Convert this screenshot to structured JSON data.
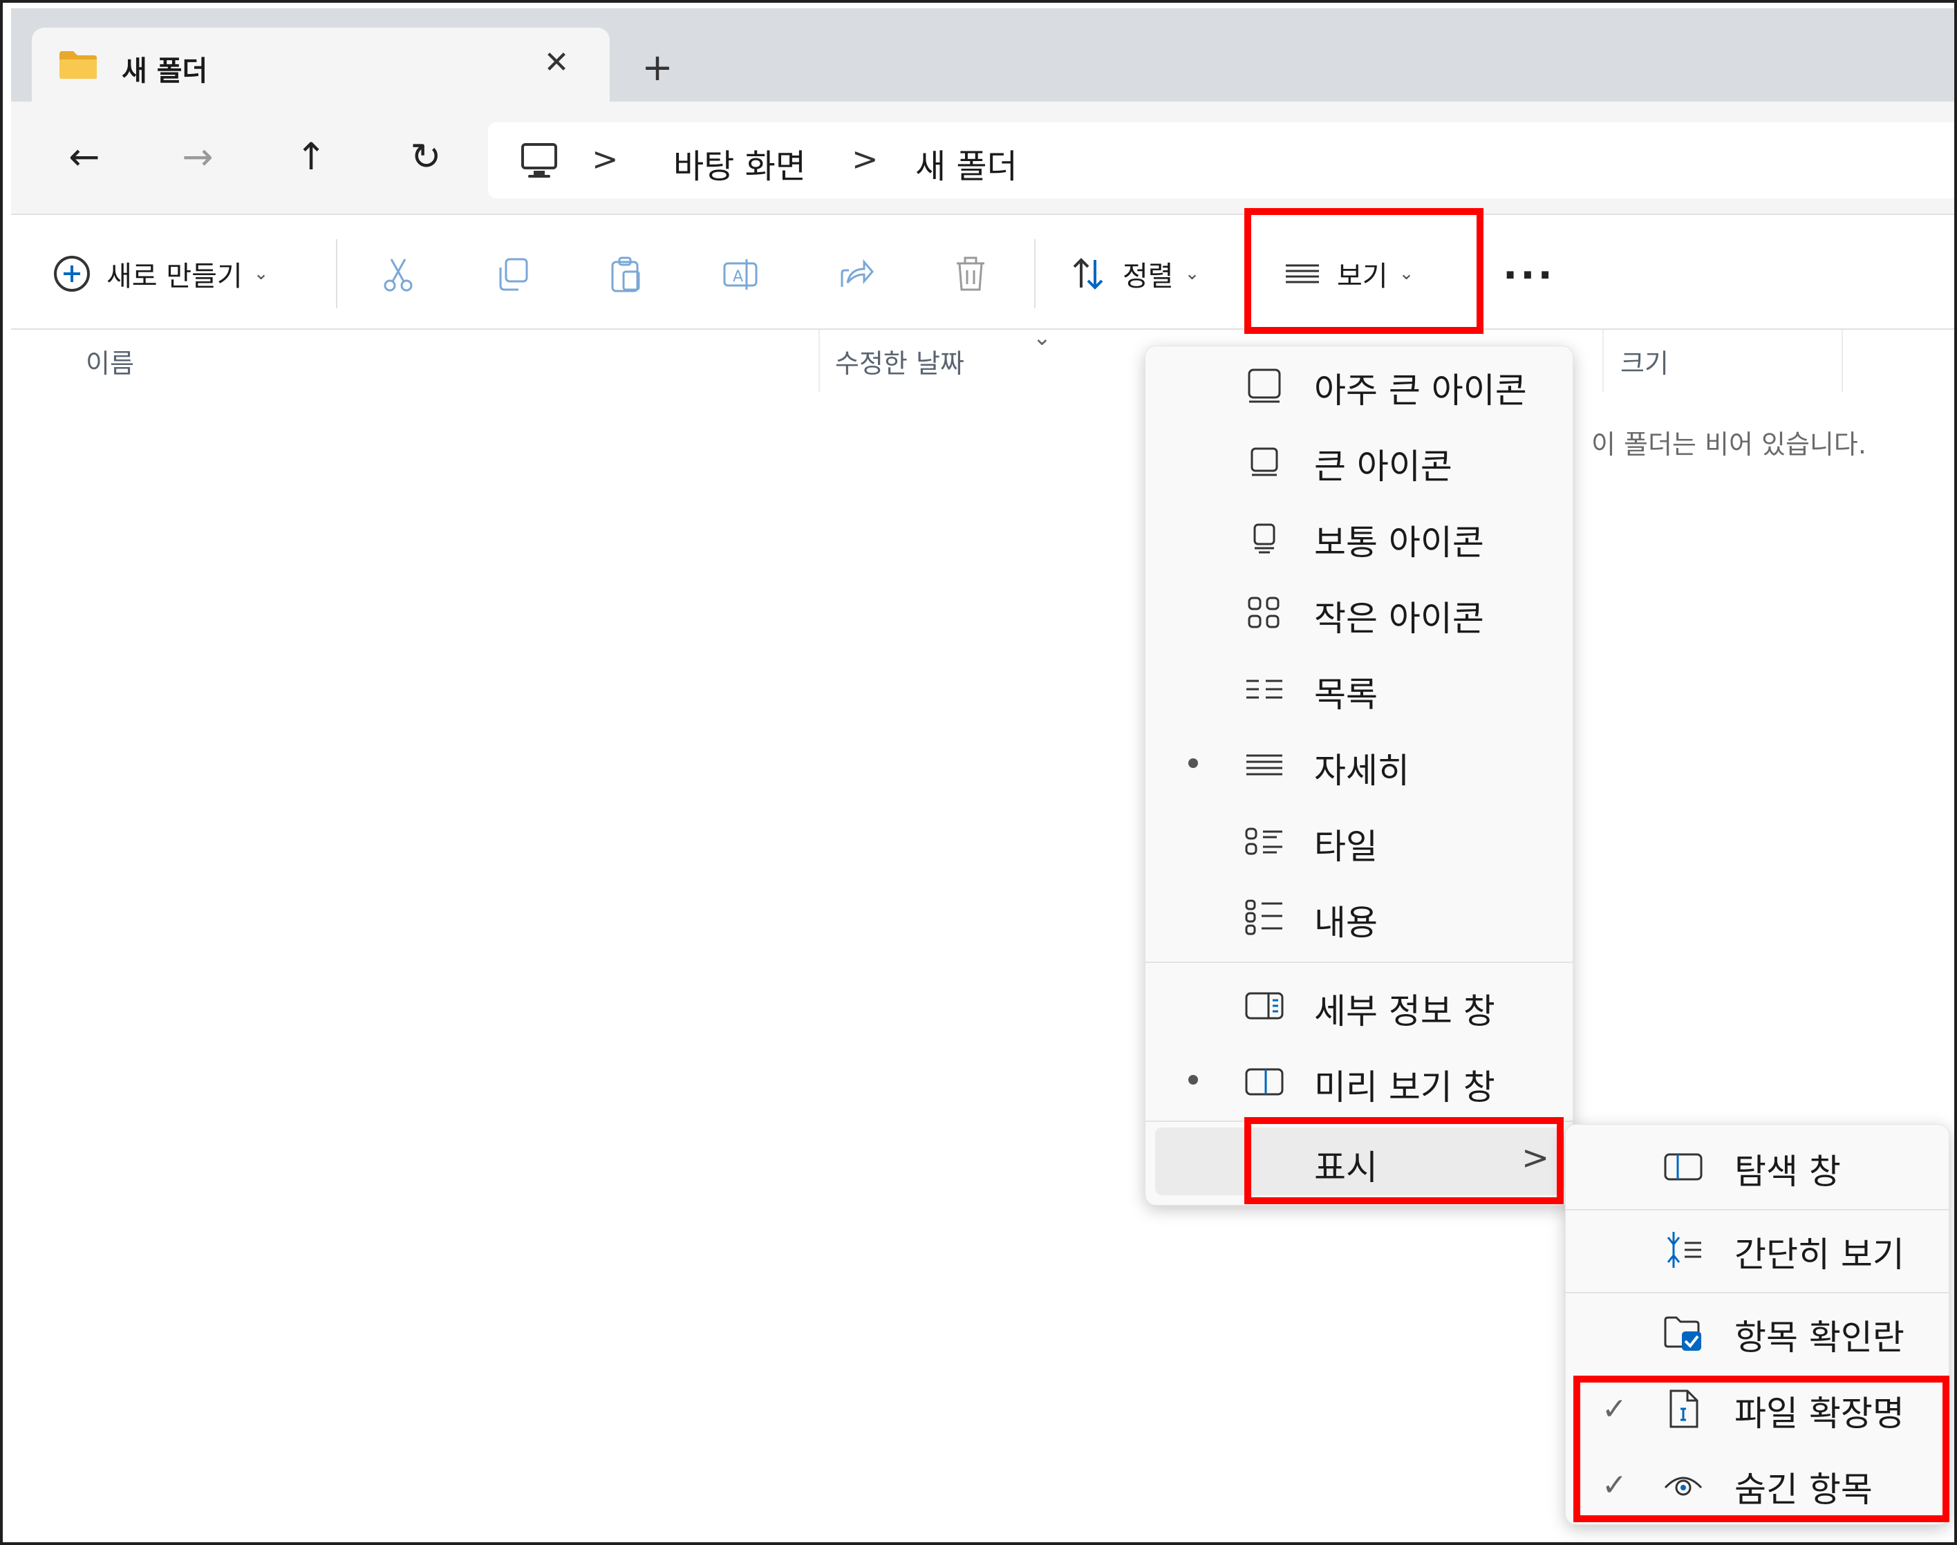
{
  "tab": {
    "title": "새 폴더",
    "close_icon": "close-icon",
    "new_tab_label": "+"
  },
  "nav": {
    "back": "←",
    "forward": "→",
    "up": "↑",
    "refresh": "↻"
  },
  "breadcrumb": {
    "items": [
      "바탕 화면",
      "새 폴더"
    ],
    "separator": ">"
  },
  "toolbar": {
    "new_label": "새로 만들기",
    "sort_label": "정렬",
    "view_label": "보기",
    "more_label": "···",
    "disabled_icons": [
      "cut-icon",
      "copy-icon",
      "paste-icon",
      "rename-icon",
      "share-icon",
      "delete-icon"
    ]
  },
  "columns": {
    "name": "이름",
    "modified": "수정한 날짜",
    "size": "크기"
  },
  "empty_message": "이 폴더는 비어 있습니다.",
  "view_menu": {
    "items": [
      {
        "label": "아주 큰 아이콘",
        "icon": "extra-large-icons-icon",
        "selected": false
      },
      {
        "label": "큰 아이콘",
        "icon": "large-icons-icon",
        "selected": false
      },
      {
        "label": "보통 아이콘",
        "icon": "medium-icons-icon",
        "selected": false
      },
      {
        "label": "작은 아이콘",
        "icon": "small-icons-icon",
        "selected": false
      },
      {
        "label": "목록",
        "icon": "list-icon",
        "selected": false
      },
      {
        "label": "자세히",
        "icon": "details-icon",
        "selected": true
      },
      {
        "label": "타일",
        "icon": "tiles-icon",
        "selected": false
      },
      {
        "label": "내용",
        "icon": "content-icon",
        "selected": false
      }
    ],
    "panes": [
      {
        "label": "세부 정보 창",
        "icon": "details-pane-icon",
        "selected": false
      },
      {
        "label": "미리 보기 창",
        "icon": "preview-pane-icon",
        "selected": true
      }
    ],
    "show_label": "표시",
    "show_arrow": ">"
  },
  "show_submenu": {
    "items": [
      {
        "label": "탐색 창",
        "icon": "navigation-pane-icon",
        "checked": false
      },
      {
        "label": "간단히 보기",
        "icon": "compact-view-icon",
        "checked": false
      },
      {
        "label": "항목 확인란",
        "icon": "item-checkboxes-icon",
        "checked": false
      },
      {
        "label": "파일 확장명",
        "icon": "file-extensions-icon",
        "checked": true
      },
      {
        "label": "숨긴 항목",
        "icon": "hidden-items-icon",
        "checked": true
      }
    ],
    "check_mark": "✓"
  },
  "colors": {
    "accent": "#0067c0",
    "highlight": "#ff0000",
    "folder": "#f2c14e"
  }
}
